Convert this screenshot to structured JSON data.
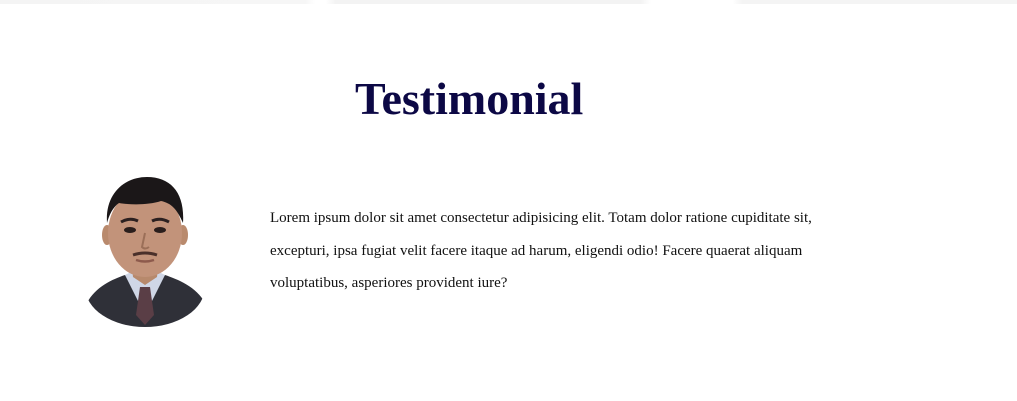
{
  "testimonial": {
    "heading": "Testimonial",
    "quote": "Lorem ipsum dolor sit amet consectetur adipisicing elit. Totam dolor ratione cupiditate sit, excepturi, ipsa fugiat velit facere itaque ad harum, eligendi odio! Facere quaerat aliquam voluptatibus, asperiores provident iure?",
    "avatar_icon": "person-portrait-icon"
  },
  "colors": {
    "heading": "#0c0845",
    "text": "#111111",
    "background": "#ffffff"
  }
}
